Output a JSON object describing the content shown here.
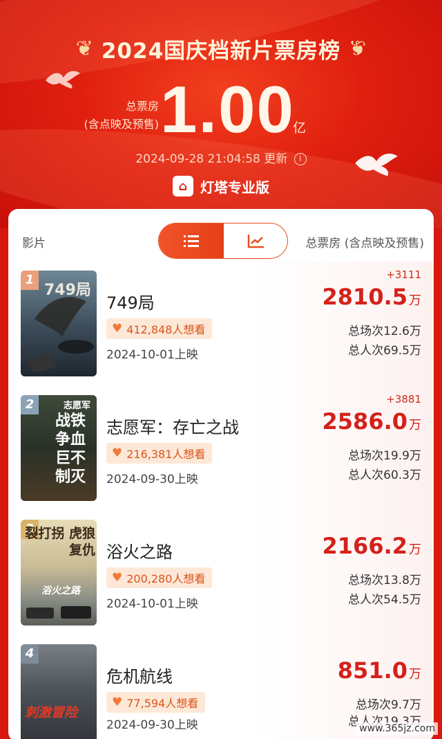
{
  "header": {
    "title": "2024国庆档新片票房榜",
    "total_label_line1": "总票房",
    "total_label_line2": "(含点映及预售)",
    "total_value": "1.00",
    "total_unit": "亿",
    "update_time": "2024-09-28 21:04:58",
    "update_suffix": "更新",
    "brand": "灯塔专业版"
  },
  "list": {
    "col_film": "影片",
    "col_total": "总票房 (含点映及预售)",
    "toggle": {
      "left_icon": "list-icon",
      "right_icon": "trend-chart-icon",
      "selected": "list"
    },
    "films": [
      {
        "rank": "1",
        "name": "749局",
        "want": "412,848人想看",
        "release": "2024-10-01上映",
        "delta": "+3111",
        "box": "2810.5",
        "unit": "万",
        "shows": "总场次12.6万",
        "viewers": "总人次69.5万"
      },
      {
        "rank": "2",
        "name": "志愿军：存亡之战",
        "want": "216,381人想看",
        "release": "2024-09-30上映",
        "delta": "+3881",
        "box": "2586.0",
        "unit": "万",
        "shows": "总场次19.9万",
        "viewers": "总人次60.3万"
      },
      {
        "rank": "3",
        "name": "浴火之路",
        "want": "200,280人想看",
        "release": "2024-10-01上映",
        "delta": "",
        "box": "2166.2",
        "unit": "万",
        "shows": "总场次13.8万",
        "viewers": "总人次54.5万"
      },
      {
        "rank": "4",
        "name": "危机航线",
        "want": "77,594人想看",
        "release": "2024-09-30上映",
        "delta": "",
        "box": "851.0",
        "unit": "万",
        "shows": "总场次9.7万",
        "viewers": "总人次19.3万"
      }
    ]
  },
  "posters": {
    "p1": "749局",
    "p2_top": "志愿军",
    "p2_big": "战铁 争血 巨不 制灭",
    "p3_big": "裂打拐 虎狼复仇",
    "p3_sub": "浴火之路",
    "p4_big": "刺激冒险"
  },
  "watermark": "www.365jz.com",
  "colors": {
    "accent": "#d4211a",
    "header_red": "#e0200f",
    "chip_bg": "#fde8d8"
  }
}
